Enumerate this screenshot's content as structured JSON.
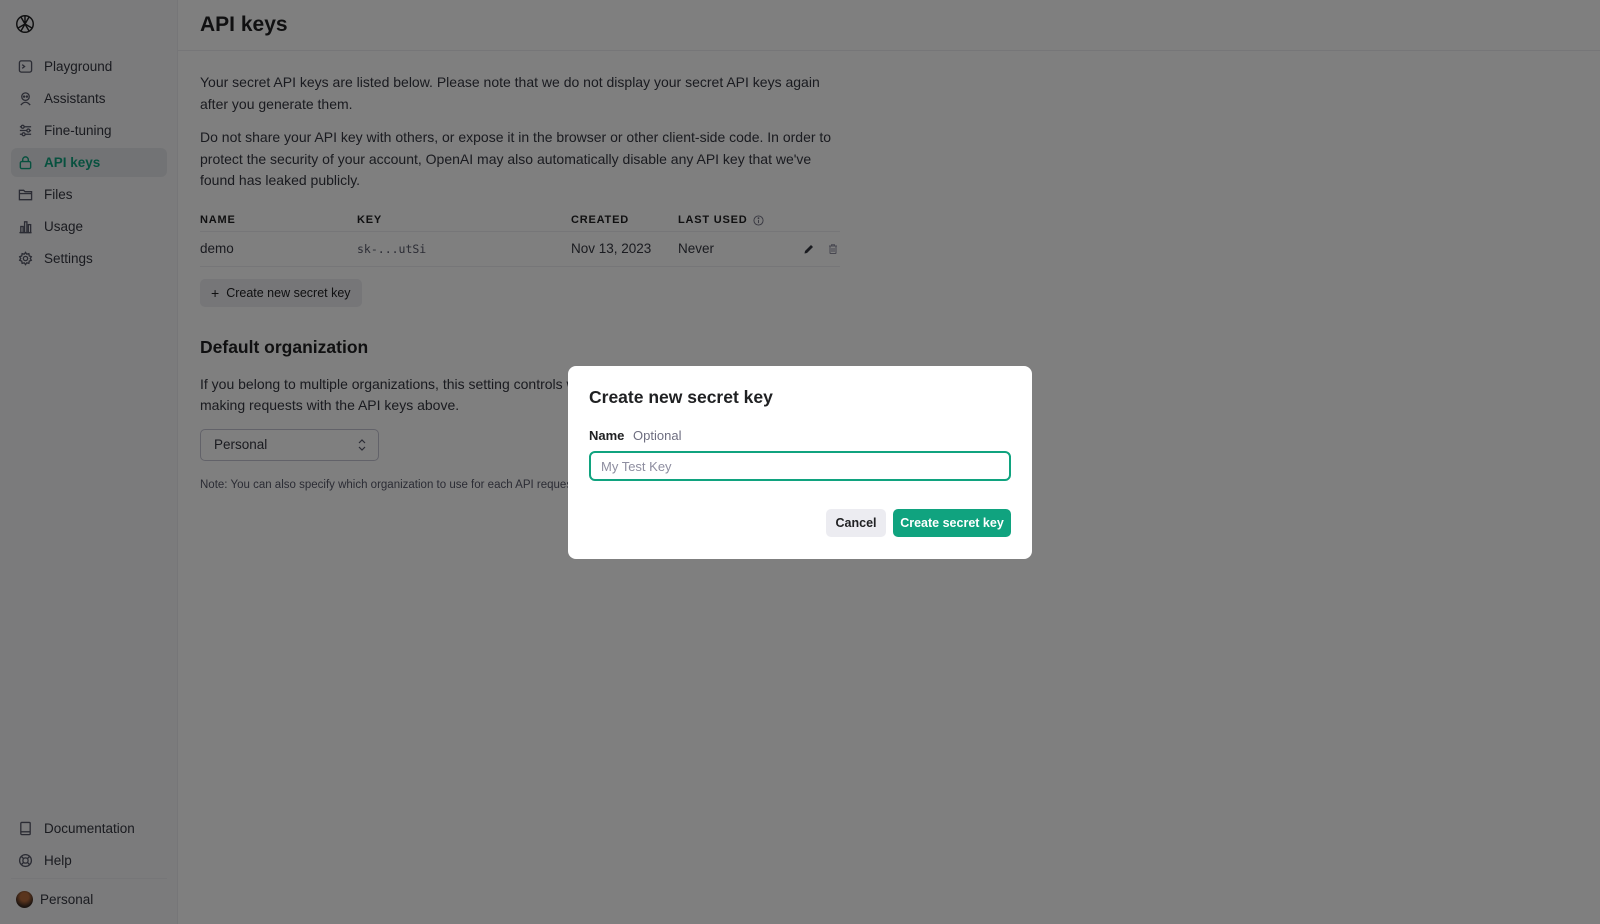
{
  "sidebar": {
    "items": [
      {
        "label": "Playground",
        "icon": "terminal-icon"
      },
      {
        "label": "Assistants",
        "icon": "robot-icon"
      },
      {
        "label": "Fine-tuning",
        "icon": "sliders-icon"
      },
      {
        "label": "API keys",
        "icon": "lock-icon",
        "active": true
      },
      {
        "label": "Files",
        "icon": "folder-icon"
      },
      {
        "label": "Usage",
        "icon": "bar-chart-icon"
      },
      {
        "label": "Settings",
        "icon": "gear-icon"
      }
    ],
    "bottom_items": [
      {
        "label": "Documentation",
        "icon": "book-icon"
      },
      {
        "label": "Help",
        "icon": "lifebuoy-icon"
      }
    ],
    "org_label": "Personal"
  },
  "header": {
    "title": "API keys"
  },
  "main": {
    "intro_1": "Your secret API keys are listed below. Please note that we do not display your secret API keys again after you generate them.",
    "intro_2": "Do not share your API key with others, or expose it in the browser or other client-side code. In order to protect the security of your account, OpenAI may also automatically disable any API key that we've found has leaked publicly.",
    "table": {
      "columns": [
        "NAME",
        "KEY",
        "CREATED",
        "LAST USED"
      ],
      "rows": [
        {
          "name": "demo",
          "key": "sk-...utSi",
          "created": "Nov 13, 2023",
          "last_used": "Never"
        }
      ]
    },
    "create_button_label": "Create new secret key",
    "default_org": {
      "title": "Default organization",
      "description": "If you belong to multiple organizations, this setting controls which organization is used by default when making requests with the API keys above.",
      "selected": "Personal",
      "note": "Note: You can also specify which organization to use for each API request."
    }
  },
  "modal": {
    "title": "Create new secret key",
    "name_label": "Name",
    "optional_label": "Optional",
    "name_placeholder": "My Test Key",
    "name_value": "",
    "cancel_label": "Cancel",
    "submit_label": "Create secret key"
  },
  "colors": {
    "accent": "#10a37f",
    "overlay": "#808080",
    "sidebar_bg": "#f7f7f8"
  }
}
